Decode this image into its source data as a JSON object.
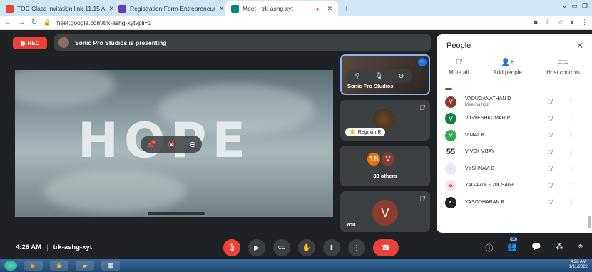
{
  "browser": {
    "tabs": [
      {
        "title": "TOC Class invitation link-11.15 A",
        "icon": "gmail-icon",
        "color": "#ea4335"
      },
      {
        "title": "Registration Form-Entrepreneur",
        "icon": "forms-icon",
        "color": "#673ab7"
      },
      {
        "title": "Meet - trk-ashg-xyt",
        "icon": "meet-icon",
        "color": "#00897b",
        "active": true
      }
    ],
    "new_tab": "+",
    "url": "meet.google.com/trk-ashg-xyt?pli=1"
  },
  "meet": {
    "rec_label": "REC",
    "presenting_text": "Sonic Pro Studios is presenting",
    "stage_text": "HOPE",
    "tiles": [
      {
        "label": "Sonic Pro Studios"
      },
      {
        "label": "Reguvin R"
      },
      {
        "badge_count": "18",
        "avatar_letter": "V",
        "label": "83 others"
      },
      {
        "avatar_letter": "V",
        "label": "You"
      }
    ],
    "time": "4:28 AM",
    "meeting_code": "trk-ashg-xyt",
    "separator": "|",
    "people_count": "87"
  },
  "people_panel": {
    "title": "People",
    "actions": [
      {
        "label": "Mute all",
        "icon": "mic-off-icon"
      },
      {
        "label": "Add people",
        "icon": "add-person-icon"
      },
      {
        "label": "Host controls",
        "icon": "toggle-icon"
      }
    ],
    "participants": [
      {
        "name": "VADUGANATHAN D",
        "sub": "Meeting host",
        "avatar": "V",
        "color": "#8e3b2e"
      },
      {
        "name": "VIGNESHKUMAR P",
        "sub": "",
        "avatar": "V",
        "color": "#0b8043"
      },
      {
        "name": "VIMAL R",
        "sub": "",
        "avatar": "V",
        "color": "#33a852"
      },
      {
        "name": "VIVEK VIJAY",
        "sub": "",
        "avatar": "55",
        "color": "#ffffff"
      },
      {
        "name": "VYSHNAVI B",
        "sub": "",
        "avatar": "",
        "color": "#e8eaf6"
      },
      {
        "name": "YAGAVI K - 20CSA63",
        "sub": "",
        "avatar": "",
        "color": "#fce4ec"
      },
      {
        "name": "YASODHARAN R",
        "sub": "",
        "avatar": "",
        "color": "#202124"
      }
    ]
  },
  "taskbar": {
    "time": "4:28 AM",
    "date": "1/11/2022"
  }
}
